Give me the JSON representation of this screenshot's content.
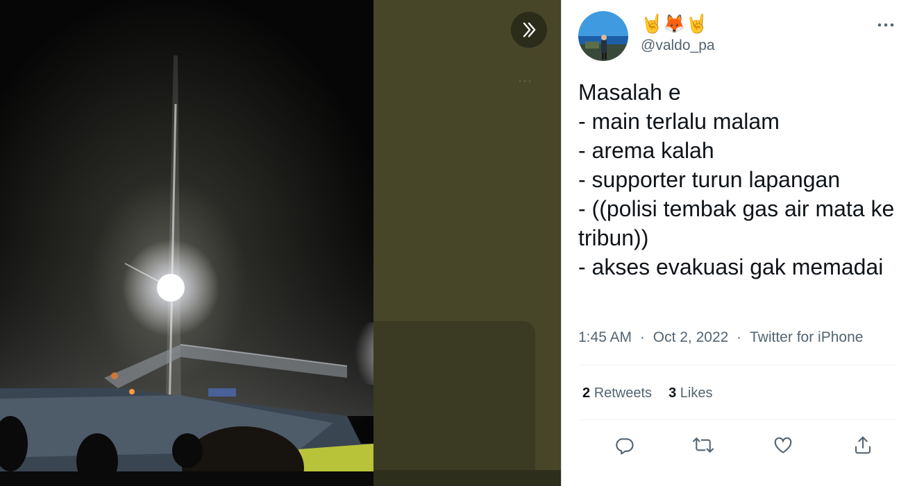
{
  "media": {
    "expand_icon": "chevrons-right-icon",
    "backdrop_more_icon": "more-horizontal-icon",
    "backdrop_more_glyph": "···"
  },
  "tweet": {
    "author": {
      "display_name": "🤘🦊🤘",
      "handle": "@valdo_pa"
    },
    "more_icon": "more-horizontal-icon",
    "text": "Masalah e\n- main terlalu malam\n- arema kalah\n- supporter turun lapangan\n- ((polisi tembak gas air mata ke tribun))\n- akses evakuasi gak memadai",
    "time": "1:45 AM",
    "date": "Oct 2, 2022",
    "separator": "·",
    "source": "Twitter for iPhone",
    "stats": {
      "retweets_count": "2",
      "retweets_label": "Retweets",
      "likes_count": "3",
      "likes_label": "Likes"
    },
    "actions": {
      "reply_icon": "reply-icon",
      "retweet_icon": "retweet-icon",
      "like_icon": "heart-icon",
      "share_icon": "share-icon"
    }
  },
  "colors": {
    "text_primary": "#0f1419",
    "text_secondary": "#536471",
    "media_backdrop": "#484628",
    "divider": "#eff3f4"
  }
}
